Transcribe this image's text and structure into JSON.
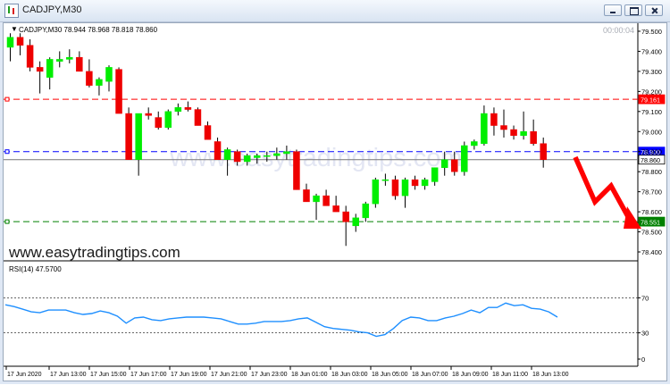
{
  "window": {
    "title": "CADJPY,M30"
  },
  "chart_data": [
    {
      "type": "candlestick",
      "symbol": "CADJPY",
      "timeframe": "M30",
      "ohlc_label": "CADJPY,M30  78.944 78.968 78.818 78.860",
      "timer": "00:00:04",
      "watermark": "www.easytradingtips.com",
      "caption": "www.easytradingtips.com",
      "ylim": [
        78.36,
        79.54
      ],
      "y_ticks": [
        "79.500",
        "79.400",
        "79.300",
        "79.200",
        "79.100",
        "79.000",
        "78.900",
        "78.800",
        "78.700",
        "78.600",
        "78.500",
        "78.400"
      ],
      "x_ticks": [
        "17 Jun 2020",
        "17 Jun 13:00",
        "17 Jun 15:00",
        "17 Jun 17:00",
        "17 Jun 19:00",
        "17 Jun 21:00",
        "17 Jun 23:00",
        "18 Jun 01:00",
        "18 Jun 03:00",
        "18 Jun 05:00",
        "18 Jun 07:00",
        "18 Jun 09:00",
        "18 Jun 11:00",
        "18 Jun 13:00"
      ],
      "candles": [
        [
          79.42,
          79.49,
          79.35,
          79.47
        ],
        [
          79.47,
          79.49,
          79.38,
          79.43
        ],
        [
          79.43,
          79.46,
          79.3,
          79.32
        ],
        [
          79.32,
          79.35,
          79.19,
          79.3
        ],
        [
          79.27,
          79.37,
          79.21,
          79.36
        ],
        [
          79.35,
          79.4,
          79.32,
          79.36
        ],
        [
          79.36,
          79.41,
          79.34,
          79.37
        ],
        [
          79.37,
          79.4,
          79.3,
          79.3
        ],
        [
          79.3,
          79.36,
          79.22,
          79.23
        ],
        [
          79.23,
          79.27,
          79.18,
          79.26
        ],
        [
          79.25,
          79.33,
          79.2,
          79.32
        ],
        [
          79.31,
          79.32,
          79.09,
          79.09
        ],
        [
          79.09,
          79.12,
          78.86,
          78.86
        ],
        [
          78.86,
          79.09,
          78.78,
          79.09
        ],
        [
          79.09,
          79.12,
          79.06,
          79.08
        ],
        [
          79.07,
          79.1,
          79.01,
          79.02
        ],
        [
          79.02,
          79.11,
          79.01,
          79.1
        ],
        [
          79.1,
          79.14,
          79.08,
          79.12
        ],
        [
          79.12,
          79.15,
          79.1,
          79.11
        ],
        [
          79.11,
          79.12,
          79.03,
          79.03
        ],
        [
          79.03,
          79.05,
          78.96,
          78.96
        ],
        [
          78.95,
          78.97,
          78.86,
          78.86
        ],
        [
          78.86,
          78.92,
          78.78,
          78.91
        ],
        [
          78.9,
          78.91,
          78.83,
          78.85
        ],
        [
          78.85,
          78.89,
          78.83,
          78.88
        ],
        [
          78.87,
          78.89,
          78.84,
          78.88
        ],
        [
          78.88,
          78.9,
          78.85,
          78.88
        ],
        [
          78.88,
          78.92,
          78.86,
          78.89
        ],
        [
          78.89,
          78.93,
          78.86,
          78.9
        ],
        [
          78.9,
          78.91,
          78.71,
          78.71
        ],
        [
          78.71,
          78.74,
          78.65,
          78.65
        ],
        [
          78.65,
          78.69,
          78.56,
          78.68
        ],
        [
          78.68,
          78.71,
          78.63,
          78.63
        ],
        [
          78.63,
          78.68,
          78.6,
          78.6
        ],
        [
          78.6,
          78.63,
          78.43,
          78.55
        ],
        [
          78.53,
          78.59,
          78.5,
          78.57
        ],
        [
          78.57,
          78.65,
          78.55,
          78.64
        ],
        [
          78.64,
          78.77,
          78.62,
          78.76
        ],
        [
          78.76,
          78.79,
          78.73,
          78.76
        ],
        [
          78.76,
          78.78,
          78.66,
          78.68
        ],
        [
          78.68,
          78.77,
          78.62,
          78.76
        ],
        [
          78.76,
          78.78,
          78.71,
          78.73
        ],
        [
          78.73,
          78.77,
          78.71,
          78.76
        ],
        [
          78.75,
          78.82,
          78.73,
          78.82
        ],
        [
          78.82,
          78.9,
          78.78,
          78.86
        ],
        [
          78.86,
          78.9,
          78.78,
          78.8
        ],
        [
          78.8,
          78.95,
          78.78,
          78.93
        ],
        [
          78.93,
          78.96,
          78.91,
          78.95
        ],
        [
          78.94,
          79.13,
          78.93,
          79.09
        ],
        [
          79.09,
          79.12,
          78.98,
          79.03
        ],
        [
          79.03,
          79.11,
          78.97,
          79.01
        ],
        [
          79.01,
          79.03,
          78.96,
          78.98
        ],
        [
          78.98,
          79.1,
          78.96,
          79.0
        ],
        [
          79.0,
          79.06,
          78.93,
          78.94
        ],
        [
          78.94,
          78.97,
          78.82,
          78.86
        ]
      ],
      "levels": [
        {
          "value": 79.161,
          "label": "79.161",
          "color": "#ff0000"
        },
        {
          "value": 78.9,
          "label": "78.900",
          "color": "#0000ff"
        },
        {
          "value": 78.86,
          "label": "78.860",
          "color": "#000000"
        },
        {
          "value": 78.551,
          "label": "78.551",
          "color": "#008000"
        }
      ],
      "bull_color": "#00ee00",
      "bear_color": "#ee0000",
      "arrow_color": "#ff0000",
      "arrow_direction": "down"
    },
    {
      "type": "line",
      "title": "RSI(14) 47.5700",
      "ylim": [
        0,
        100
      ],
      "y_ticks": [
        "70",
        "30",
        "0"
      ],
      "levels": [
        70,
        30
      ],
      "series": [
        {
          "color": "#1e8fff",
          "values": [
            62,
            60,
            57,
            54,
            53,
            56,
            56,
            56,
            53,
            51,
            52,
            55,
            53,
            49,
            41,
            47,
            48,
            45,
            44,
            46,
            47,
            48,
            48,
            48,
            47,
            46,
            43,
            40,
            40,
            41,
            43,
            43,
            43,
            44,
            46,
            47,
            42,
            37,
            35,
            34,
            33,
            31,
            30,
            26,
            28,
            35,
            44,
            48,
            47,
            44,
            44,
            47,
            49,
            52,
            56,
            53,
            59,
            59,
            64,
            61,
            62,
            58,
            57,
            54,
            48
          ]
        }
      ]
    }
  ]
}
